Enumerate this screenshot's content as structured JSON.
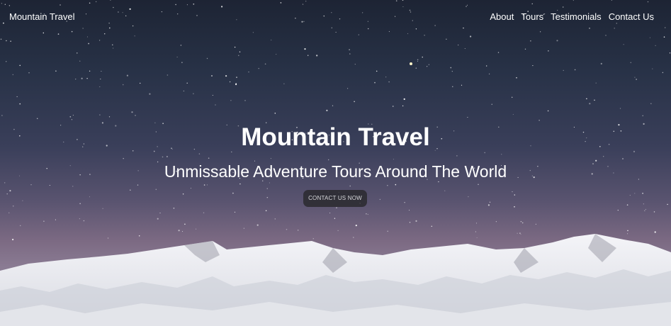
{
  "nav": {
    "brand": "Mountain Travel",
    "links": [
      "About",
      "Tours",
      "Testimonials",
      "Contact Us"
    ]
  },
  "hero": {
    "title": "Mountain Travel",
    "subtitle": "Unmissable Adventure Tours Around The World",
    "cta_label": "CONTACT US NOW"
  },
  "colors": {
    "sky_top": "#1d2434",
    "sky_bottom": "#9a91a6",
    "snow": "#eef0f4",
    "button_bg": "#28282c"
  }
}
